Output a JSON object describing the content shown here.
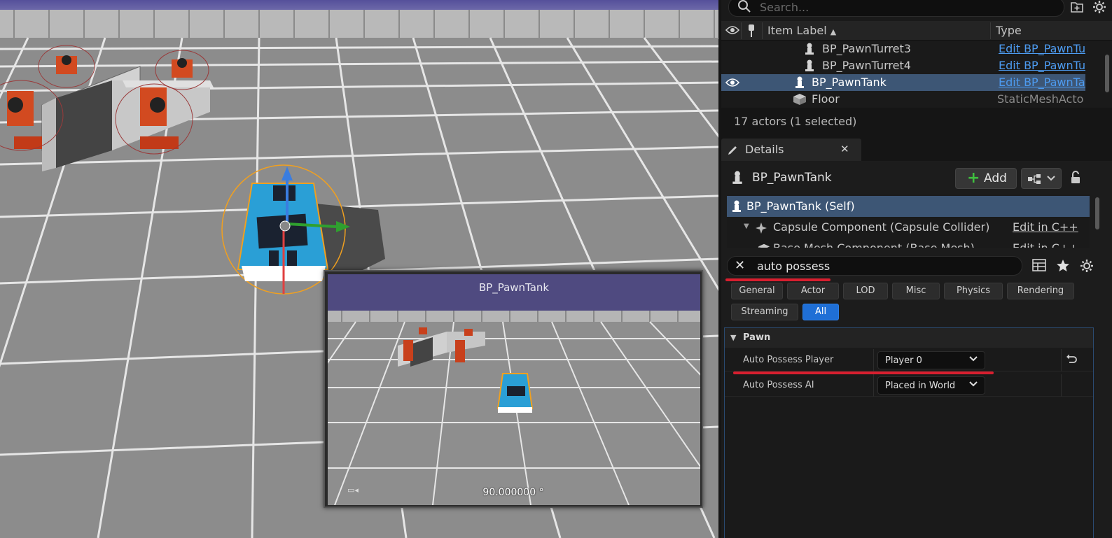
{
  "viewport": {
    "preview": {
      "title": "BP_PawnTank",
      "angle": "90.000000 °"
    }
  },
  "outliner": {
    "search_placeholder": "Search...",
    "columns": {
      "label": "Item Label",
      "type": "Type"
    },
    "rows": [
      {
        "label": "BP_PawnTurret3",
        "type": "Edit BP_PawnTurret",
        "selected": false
      },
      {
        "label": "BP_PawnTurret4",
        "type": "Edit BP_PawnTurret",
        "selected": false
      },
      {
        "label": "BP_PawnTank",
        "type": "Edit BP_PawnTank",
        "selected": true
      },
      {
        "label": "Floor",
        "type": "StaticMeshActor",
        "selected": false
      }
    ],
    "actor_count": "17 actors (1 selected)"
  },
  "details": {
    "tab_label": "Details",
    "close_glyph": "✕",
    "object_name": "BP_PawnTank",
    "add_label": "Add",
    "components": [
      {
        "label": "BP_PawnTank (Self)",
        "edit": "",
        "selected": true
      },
      {
        "label": "Capsule Component (Capsule Collider)",
        "edit": "Edit in C++",
        "selected": false
      },
      {
        "label": "Base Mesh Component (Base Mesh)",
        "edit": "Edit in C++",
        "selected": false
      }
    ],
    "filter_value": "auto possess",
    "categories": [
      "General",
      "Actor",
      "LOD",
      "Misc",
      "Physics",
      "Rendering",
      "Streaming",
      "All"
    ],
    "active_category": "All",
    "section": {
      "title": "Pawn",
      "properties": [
        {
          "name": "Auto Possess Player",
          "value": "Player 0"
        },
        {
          "name": "Auto Possess AI",
          "value": "Placed in World"
        }
      ]
    }
  },
  "colors": {
    "accent": "#1f6fd6",
    "selection": "#3d5675",
    "link": "#4d9bf0",
    "annotation_red": "#d81f2f",
    "preview_header": "#4f4a80"
  }
}
